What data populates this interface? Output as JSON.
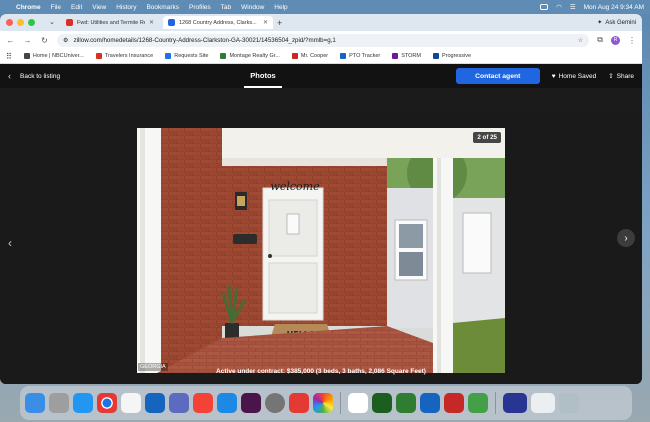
{
  "menubar": {
    "apple": "",
    "app": "Chrome",
    "items": [
      "File",
      "Edit",
      "View",
      "History",
      "Bookmarks",
      "Profiles",
      "Tab",
      "Window",
      "Help"
    ],
    "datetime": "Mon Aug 24  9:34 AM"
  },
  "tabs": [
    {
      "title": "Fwd: Utilities and Termite Re...",
      "favicon_color": "#d93025"
    },
    {
      "title": "1268 Country Address, Clarks...",
      "favicon_color": "#1f66e0"
    }
  ],
  "browser": {
    "ask_gemini": "Ask Gemini",
    "url": "zillow.com/homedetails/1268-Country-Address-Clarkston-GA-30021/14536504_zpid/?mmlb=g,1",
    "profile_initial": "R"
  },
  "bookmarks": [
    {
      "label": "Home | NBCUniver...",
      "color": "#444"
    },
    {
      "label": "Travelers Insurance",
      "color": "#d93025"
    },
    {
      "label": "Requests Site",
      "color": "#1a73e8"
    },
    {
      "label": "Montage Realty Gr...",
      "color": "#2e7d32"
    },
    {
      "label": "Mr. Cooper",
      "color": "#c62828"
    },
    {
      "label": "PTO Tracker",
      "color": "#1565c0"
    },
    {
      "label": "STORM",
      "color": "#6a1b9a"
    },
    {
      "label": "Progressive",
      "color": "#0d47a1"
    }
  ],
  "viewer": {
    "back_label": "Back to listing",
    "title": "Photos",
    "contact_label": "Contact agent",
    "saved_label": "Home Saved",
    "share_label": "Share",
    "counter": "2 of 25",
    "watermark": "GEORGIA",
    "caption": "Active under contract: $385,000 (3 beds, 3 baths, 2,086 Square Feet)",
    "sign_welcome": "welcome",
    "mat_text": "HELLO"
  },
  "dock": {
    "icons": [
      {
        "name": "finder-icon",
        "color": "#3a8ee6"
      },
      {
        "name": "launchpad-icon",
        "color": "#9e9e9e"
      },
      {
        "name": "safari-icon",
        "color": "#2196f3"
      },
      {
        "name": "chrome-icon",
        "color": "#e53935"
      },
      {
        "name": "reminders-icon",
        "color": "#f5f5f5"
      },
      {
        "name": "outlook-icon",
        "color": "#1565c0"
      },
      {
        "name": "teams-icon",
        "color": "#5c6bc0"
      },
      {
        "name": "news-icon",
        "color": "#f44336"
      },
      {
        "name": "app-store-icon",
        "color": "#1e88e5"
      },
      {
        "name": "slack-icon",
        "color": "#4a154b"
      },
      {
        "name": "system-settings-icon",
        "color": "#757575"
      },
      {
        "name": "zoom-icon",
        "color": "#e53935"
      },
      {
        "name": "photos-icon",
        "color": "#ff9800"
      },
      {
        "name": "calendar-icon",
        "color": "#ffffff"
      },
      {
        "name": "numbers-icon",
        "color": "#1b5e20"
      },
      {
        "name": "excel-icon",
        "color": "#2e7d32"
      },
      {
        "name": "word-icon",
        "color": "#1565c0"
      },
      {
        "name": "acrobat-icon",
        "color": "#c62828"
      },
      {
        "name": "messages-icon",
        "color": "#43a047"
      },
      {
        "name": "screen-preview-icon",
        "color": "#283593"
      },
      {
        "name": "window-preview-icon",
        "color": "#eceff1"
      },
      {
        "name": "trash-icon",
        "color": "#b0bec5"
      }
    ]
  }
}
